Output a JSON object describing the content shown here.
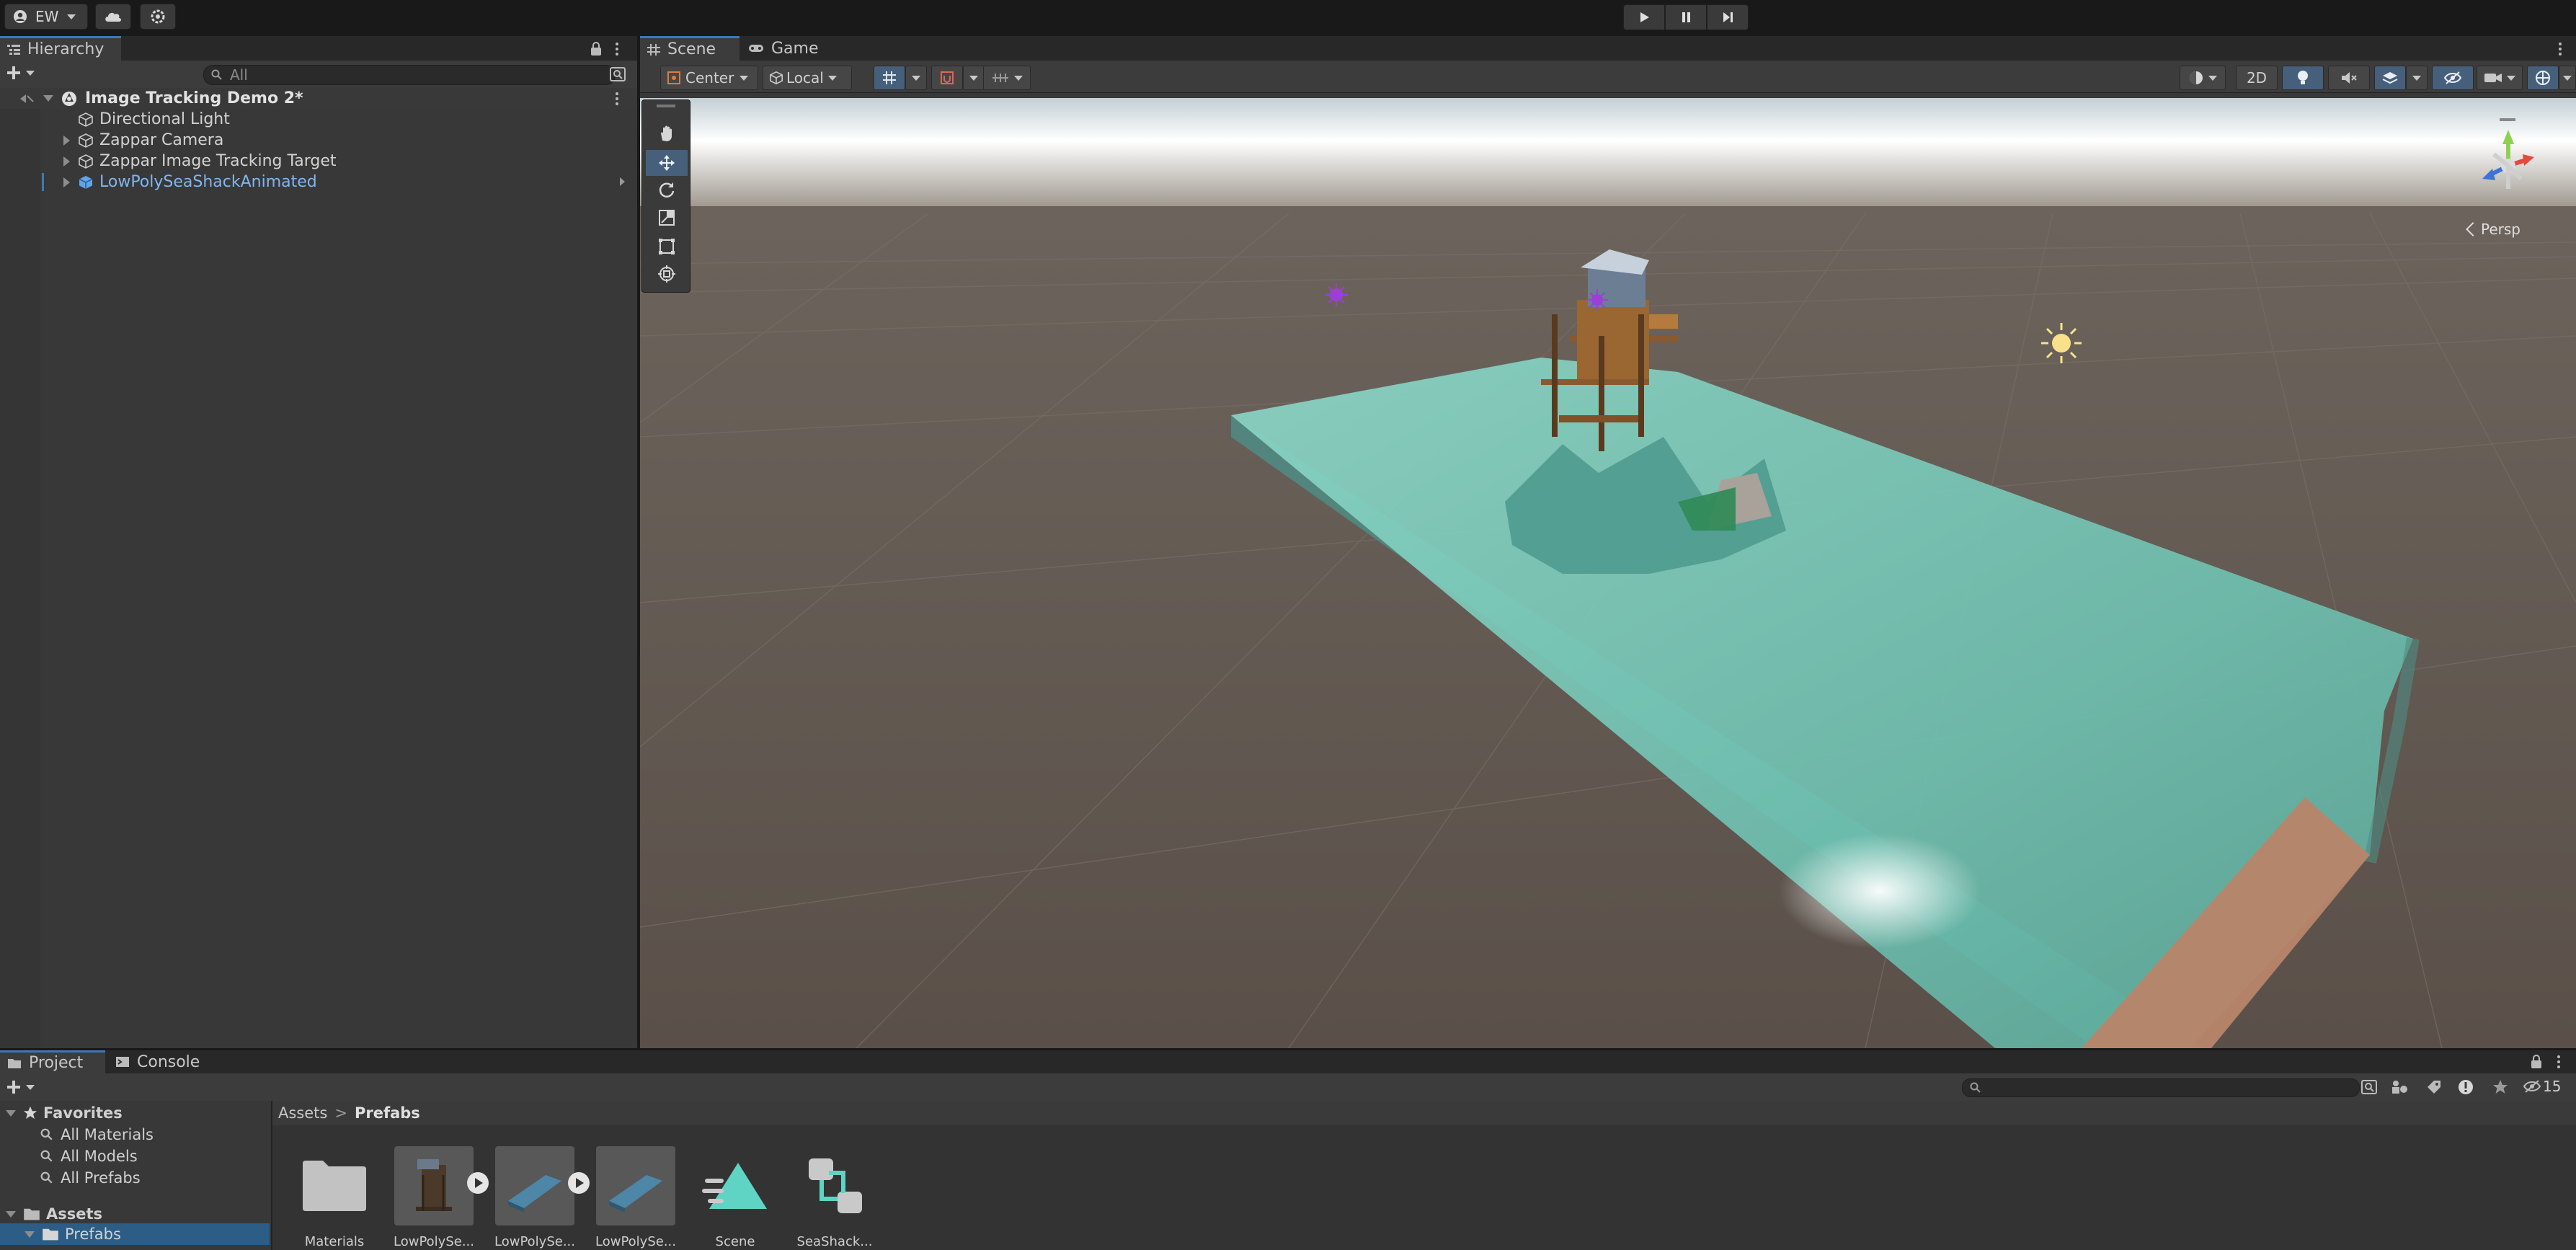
{
  "toolbar": {
    "account_label": "EW",
    "icons": [
      "user-circle-icon",
      "cloud-icon",
      "settings-icon",
      "play-icon",
      "pause-icon",
      "step-icon"
    ]
  },
  "hierarchy": {
    "tab_label": "Hierarchy",
    "search_placeholder": "All",
    "scene_name": "Image Tracking Demo 2*",
    "items": [
      {
        "label": "Directional Light"
      },
      {
        "label": "Zappar Camera"
      },
      {
        "label": "Zappar Image Tracking Target"
      },
      {
        "label": "LowPolySeaShackAnimated"
      }
    ]
  },
  "scene_view": {
    "tabs": [
      {
        "label": "Scene"
      },
      {
        "label": "Game"
      }
    ],
    "pivot_mode": "Center",
    "pivot_rotation": "Local",
    "mode_2d": "2D",
    "gizmo_label": "Persp",
    "colors": {
      "water": "#6ec3b6",
      "ground": "#5d554f",
      "sky": "#e8eeef",
      "accent_blue": "#3a79bb",
      "prefab_blue": "#7fb6f0"
    }
  },
  "project": {
    "tabs": [
      {
        "label": "Project"
      },
      {
        "label": "Console"
      }
    ],
    "hidden_count": "15",
    "favorites_label": "Favorites",
    "favorites": [
      {
        "label": "All Materials"
      },
      {
        "label": "All Models"
      },
      {
        "label": "All Prefabs"
      }
    ],
    "assets_label": "Assets",
    "prefabs_folder": "Prefabs",
    "breadcrumb": {
      "root": "Assets",
      "sep": ">",
      "current": "Prefabs"
    },
    "assets": [
      {
        "label": "Materials"
      },
      {
        "label": "LowPolySe..."
      },
      {
        "label": "LowPolySe..."
      },
      {
        "label": "LowPolySe..."
      },
      {
        "label": "Scene"
      },
      {
        "label": "SeaShack..."
      }
    ]
  }
}
